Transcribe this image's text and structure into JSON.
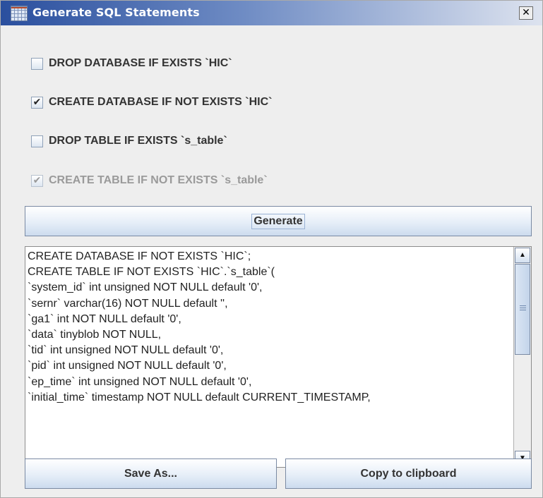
{
  "window": {
    "title": "Generate SQL Statements",
    "close_glyph": "✕",
    "app_icon": "table-icon"
  },
  "options": [
    {
      "label": "DROP DATABASE IF EXISTS `HIC`",
      "checked": false,
      "enabled": true,
      "mark": ""
    },
    {
      "label": "CREATE DATABASE IF NOT EXISTS `HIC`",
      "checked": true,
      "enabled": true,
      "mark": "✔"
    },
    {
      "label": "DROP TABLE IF EXISTS `s_table`",
      "checked": false,
      "enabled": true,
      "mark": ""
    },
    {
      "label": "CREATE TABLE IF NOT EXISTS `s_table`",
      "checked": true,
      "enabled": false,
      "mark": "✔"
    }
  ],
  "generate_button": {
    "label": "Generate"
  },
  "output": {
    "lines": [
      "CREATE DATABASE IF NOT EXISTS `HIC`;",
      "CREATE TABLE IF NOT EXISTS `HIC`.`s_table`(",
      "`system_id` int unsigned NOT NULL default '0',",
      "`sernr` varchar(16) NOT NULL default '',",
      "`ga1` int NOT NULL default '0',",
      "`data` tinyblob NOT NULL,",
      "`tid` int unsigned NOT NULL default '0',",
      "`pid` int unsigned NOT NULL default '0',",
      "`ep_time` int unsigned NOT NULL default '0',",
      "`initial_time` timestamp NOT NULL default CURRENT_TIMESTAMP,"
    ],
    "scroll_up_glyph": "▲",
    "scroll_down_glyph": "▼"
  },
  "buttons": {
    "save_as": "Save As...",
    "copy": "Copy to clipboard"
  },
  "colors": {
    "titlebar_start": "#2a4f9e",
    "titlebar_end": "#dde3ef",
    "window_bg": "#eeeeee",
    "disabled_text": "#9a9a9a"
  }
}
